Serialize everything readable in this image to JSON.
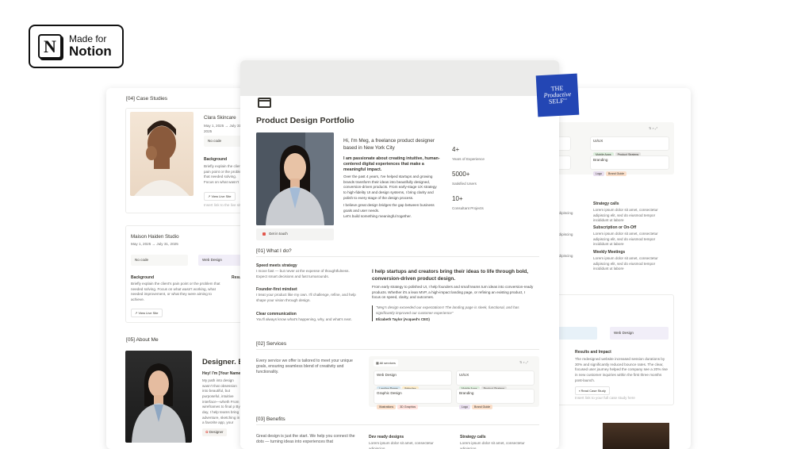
{
  "badge": {
    "line1": "Made for",
    "line2": "Notion",
    "logo": "N"
  },
  "tps": {
    "l1": "THE",
    "l2": "Productive",
    "l3": "SELF",
    "l4": "CO"
  },
  "left": {
    "case_header": "[04] Case Studies",
    "clara": {
      "title": "Clara Skincare",
      "date": "May 1, 2025 → July 31, 2025",
      "nocode": "No code",
      "background_h": "Background",
      "background_t": "Briefly explain the client's pain point or the problem that needed solving. Focus on what wasn't working, what needed improvement, or what they were aiming to achieve.",
      "live": "View Live Site",
      "hint": "Insert link to the live site"
    },
    "maison": {
      "title": "Maison Haiden Studio",
      "date": "May 1, 2025 → July 31, 2025",
      "nocode": "No code",
      "webdesign": "Web Design",
      "background_h": "Background",
      "background_t": "Briefly explain the client's pain point or the problem that needed solving. Focus on what wasn't working, what needed improvement, or what they were aiming to achieve.",
      "results_h": "Resu",
      "live": "View Live Site"
    },
    "about_header": "[05] About Me",
    "about": {
      "title": "Designer. Buil",
      "hey": "Hey! I'm [Your Name",
      "text": "My path into design wasn't that obsession into beautiful, but purposeful, intuitive interface—wheth From wireframes to final p By day, I help teams bring adventure, sketching in a favorite app, your collection",
      "tag": "Designer"
    }
  },
  "right": {
    "ux": "UI/UX",
    "ux_tags": [
      "Mobile Apps",
      "Product Strategy"
    ],
    "branding": "Branding",
    "branding_tags": [
      "Logo",
      "Brand Guide"
    ],
    "strategy_h": "Strategy calls",
    "strategy_t": "Lorem ipsum dolor sit amet, consectetur adipiscing elit, sed do eiusmod tempor incididunt ut labore",
    "sub_h": "Subscription or On-Off",
    "sub_t": "Lorem ipsum dolor sit amet, consectetur adipiscing elit, sed do eiusmod tempor incididunt ut labore",
    "weekly_h": "Weekly Meetings",
    "weekly_t": "Lorem ipsum dolor sit amet, consectetur adipiscing elit, sed do eiusmod tempor incididunt ut labore",
    "frag1": "adipiscing",
    "frag2": "adipiscing",
    "frag3": "adipiscing",
    "webdesign": "Web Design",
    "results_h": "Results and Impact",
    "results_t": "The redesigned website increased session durations by 30% and significantly reduced bounce rates. The clear, focused user journey helped the company see a 20% rise in new customer inquiries within the first three months post-launch.",
    "read": "Read Case Study",
    "read_hint": "Insert link to your full case study here"
  },
  "main": {
    "title": "Product Design Portfolio",
    "hi": "Hi, I'm Meg, a freelance product designer based in New York City",
    "passion": "I am passionate about creating intuitive, human-centered digital experiences that make a meaningful impact.",
    "p1": "Over the past 4 years, I've helped startups and growing brands transform their ideas into beautifully designed, conversion-driven products. From early-stage UX strategy to high-fidelity UI and design systems, I bring clarity and polish to every stage of the design process.",
    "p2": "I believe great design bridges the gap between business goals and user needs.",
    "p3": "Let's build something meaningful together.",
    "stats": [
      {
        "v": "4+",
        "l": "Years of Experience"
      },
      {
        "v": "5000+",
        "l": "Satisfied Users"
      },
      {
        "v": "10+",
        "l": "Consultant Projects"
      }
    ],
    "cta": "Get in touch",
    "what_h": "[01] What I do?",
    "items": [
      {
        "h": "Speed meets strategy",
        "t": "I move fast — but never at the expense of thoughtfulness. Expect smart decisions and fast turnarounds."
      },
      {
        "h": "Founder-first mindset",
        "t": "I treat your product like my own. I'll challenge, refine, and help shape your vision through design."
      },
      {
        "h": "Clear communication",
        "t": "You'll always know what's happening, why, and what's next."
      }
    ],
    "help_h": "I help startups and creators bring their ideas to life through bold, conversion-driven product design.",
    "help_t": "From early strategy to polished UI, I help founders and small teams turn ideas into conversion-ready products. Whether it's a lean MVP, a high-impact landing page, or refining an existing product, I focus on speed, clarity, and outcomes.",
    "quote": "\"Meg's design exceeded our expectations! The landing page is sleek, functional, and has significantly improved our customer experience\"",
    "quote_by": "Elizabeth Taylor (Acqued's CEO)",
    "services_h": "[02] Services",
    "services_t": "Every service we offer is tailored to meet your unique goals, ensuring seamless blend of creativity and functionality.",
    "all": "All services",
    "svc": [
      {
        "n": "Web Design",
        "tags": [
          "Landing Pages",
          "Websites"
        ]
      },
      {
        "n": "UI/UX",
        "tags": [
          "Mobile Apps",
          "Product Strategy"
        ]
      },
      {
        "n": "Graphic Design",
        "tags": [
          "Illustrations",
          "3D Graphics"
        ]
      },
      {
        "n": "Branding",
        "tags": [
          "Logo",
          "Brand Guide"
        ]
      }
    ],
    "benefits_h": "[03] Benefits",
    "benefits_t": "Great design is just the start. We help you connect the dots — turning ideas into experiences that",
    "dev_h": "Dev ready designs",
    "dev_t": "Lorem ipsum dolor sit amet, consectetur adipiscing",
    "strat_h": "Strategy calls",
    "strat_t": "Lorem ipsum dolor sit amet, consectetur adipiscing"
  }
}
